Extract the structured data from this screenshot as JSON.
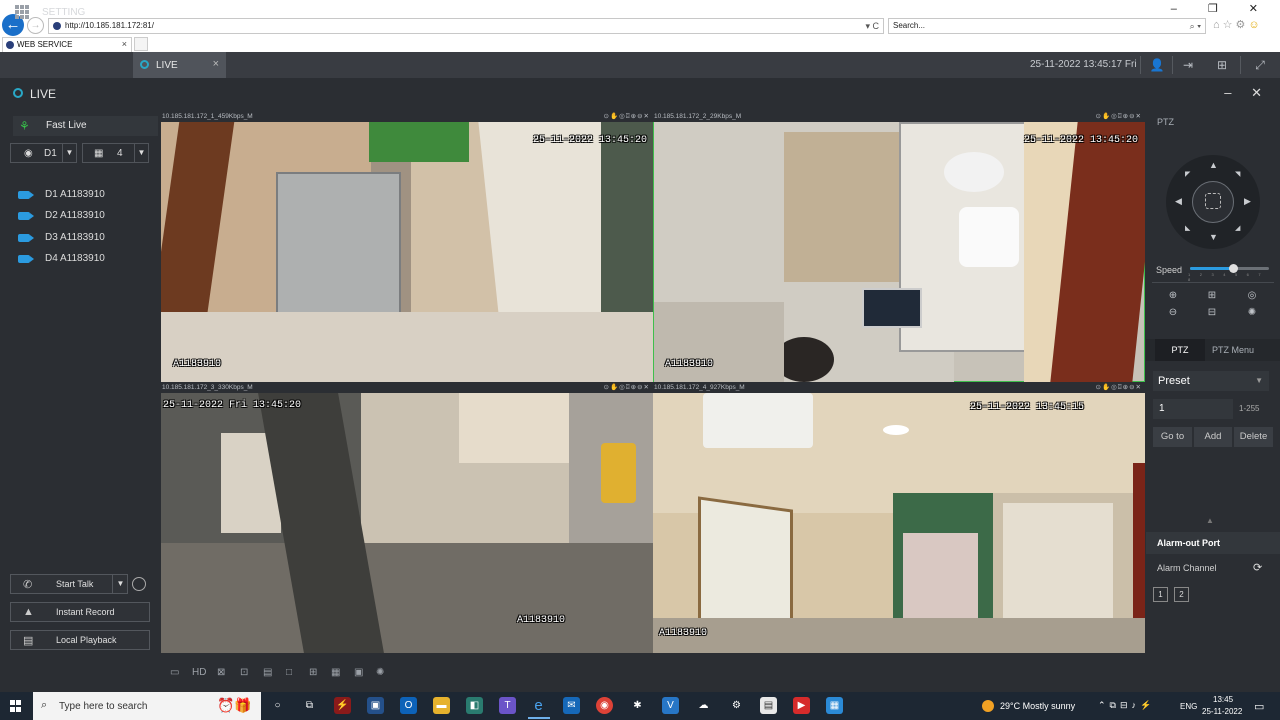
{
  "browser": {
    "url": "http://10.185.181.172:81/",
    "search_placeholder": "Search...",
    "tab_title": "WEB SERVICE",
    "tab_close": "×",
    "window_controls": "–  ❐  ✕",
    "address_tools": "▾ C",
    "search_tools": "⌕ ▾"
  },
  "app_bar": {
    "setting_label": "SETTING",
    "live_tab_label": "LIVE",
    "live_tab_close": "×",
    "datetime": "25-11-2022 13:45:17 Fri"
  },
  "live_header": {
    "title": "LIVE",
    "controls": "– ✕"
  },
  "left_panel": {
    "fast_live": "Fast Live",
    "device_select": "D1",
    "split_select": "4",
    "channels": [
      {
        "label": "D1 A1183910"
      },
      {
        "label": "D2 A1183910"
      },
      {
        "label": "D3 A1183910"
      },
      {
        "label": "D4 A1183910"
      }
    ],
    "start_talk": "Start Talk",
    "instant_record": "Instant Record",
    "local_playback": "Local Playback"
  },
  "cameras": [
    {
      "header": "10.185.181.172_1_459Kbps_M",
      "timestamp": "25-11-2022 13:45:20",
      "name": "A1183910"
    },
    {
      "header": "10.185.181.172_2_29Kbps_M",
      "timestamp": "25-11-2022 13:45:20",
      "name": "A1183910"
    },
    {
      "header": "10.185.181.172_3_330Kbps_M",
      "timestamp": "25-11-2022 Fri 13:45:20",
      "name": "A1183910"
    },
    {
      "header": "10.185.181.172_4_927Kbps_M",
      "timestamp": "25-11-2022 13:45:15",
      "name": "A1183910"
    }
  ],
  "bottom_toolbar": {
    "quality_label": "HD"
  },
  "ptz": {
    "title": "PTZ",
    "speed_label": "Speed",
    "speed_ticks": "1 2 3 4 5 6 7 8",
    "speed_value": 5,
    "tab_ptz": "PTZ",
    "tab_menu": "PTZ Menu",
    "preset_select": "Preset",
    "preset_value": "1",
    "preset_range": "1-255",
    "goto_label": "Go to",
    "add_label": "Add",
    "delete_label": "Delete",
    "alarm_out_title": "Alarm-out Port",
    "alarm_channel_label": "Alarm Channel",
    "alarm_ports": [
      "1",
      "2"
    ]
  },
  "taskbar": {
    "search_text": "Type here to search",
    "weather": "29°C  Mostly sunny",
    "language": "ENG",
    "time": "13:45",
    "date": "25-11-2022"
  },
  "colors": {
    "accent": "#2b9be0",
    "live_green": "#37c14a",
    "panel_bg": "#2b2e33",
    "selected_border": "#3fbf4c"
  }
}
